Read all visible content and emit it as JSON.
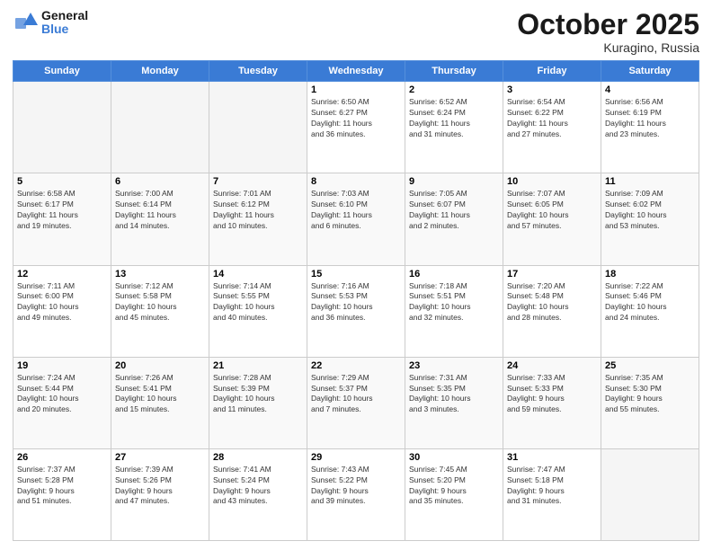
{
  "header": {
    "logo_line1": "General",
    "logo_line2": "Blue",
    "title": "October 2025",
    "subtitle": "Kuragino, Russia"
  },
  "days_of_week": [
    "Sunday",
    "Monday",
    "Tuesday",
    "Wednesday",
    "Thursday",
    "Friday",
    "Saturday"
  ],
  "weeks": [
    [
      {
        "day": "",
        "empty": true
      },
      {
        "day": "",
        "empty": true
      },
      {
        "day": "",
        "empty": true
      },
      {
        "day": "1",
        "info": "Sunrise: 6:50 AM\nSunset: 6:27 PM\nDaylight: 11 hours\nand 36 minutes."
      },
      {
        "day": "2",
        "info": "Sunrise: 6:52 AM\nSunset: 6:24 PM\nDaylight: 11 hours\nand 31 minutes."
      },
      {
        "day": "3",
        "info": "Sunrise: 6:54 AM\nSunset: 6:22 PM\nDaylight: 11 hours\nand 27 minutes."
      },
      {
        "day": "4",
        "info": "Sunrise: 6:56 AM\nSunset: 6:19 PM\nDaylight: 11 hours\nand 23 minutes."
      }
    ],
    [
      {
        "day": "5",
        "info": "Sunrise: 6:58 AM\nSunset: 6:17 PM\nDaylight: 11 hours\nand 19 minutes."
      },
      {
        "day": "6",
        "info": "Sunrise: 7:00 AM\nSunset: 6:14 PM\nDaylight: 11 hours\nand 14 minutes."
      },
      {
        "day": "7",
        "info": "Sunrise: 7:01 AM\nSunset: 6:12 PM\nDaylight: 11 hours\nand 10 minutes."
      },
      {
        "day": "8",
        "info": "Sunrise: 7:03 AM\nSunset: 6:10 PM\nDaylight: 11 hours\nand 6 minutes."
      },
      {
        "day": "9",
        "info": "Sunrise: 7:05 AM\nSunset: 6:07 PM\nDaylight: 11 hours\nand 2 minutes."
      },
      {
        "day": "10",
        "info": "Sunrise: 7:07 AM\nSunset: 6:05 PM\nDaylight: 10 hours\nand 57 minutes."
      },
      {
        "day": "11",
        "info": "Sunrise: 7:09 AM\nSunset: 6:02 PM\nDaylight: 10 hours\nand 53 minutes."
      }
    ],
    [
      {
        "day": "12",
        "info": "Sunrise: 7:11 AM\nSunset: 6:00 PM\nDaylight: 10 hours\nand 49 minutes."
      },
      {
        "day": "13",
        "info": "Sunrise: 7:12 AM\nSunset: 5:58 PM\nDaylight: 10 hours\nand 45 minutes."
      },
      {
        "day": "14",
        "info": "Sunrise: 7:14 AM\nSunset: 5:55 PM\nDaylight: 10 hours\nand 40 minutes."
      },
      {
        "day": "15",
        "info": "Sunrise: 7:16 AM\nSunset: 5:53 PM\nDaylight: 10 hours\nand 36 minutes."
      },
      {
        "day": "16",
        "info": "Sunrise: 7:18 AM\nSunset: 5:51 PM\nDaylight: 10 hours\nand 32 minutes."
      },
      {
        "day": "17",
        "info": "Sunrise: 7:20 AM\nSunset: 5:48 PM\nDaylight: 10 hours\nand 28 minutes."
      },
      {
        "day": "18",
        "info": "Sunrise: 7:22 AM\nSunset: 5:46 PM\nDaylight: 10 hours\nand 24 minutes."
      }
    ],
    [
      {
        "day": "19",
        "info": "Sunrise: 7:24 AM\nSunset: 5:44 PM\nDaylight: 10 hours\nand 20 minutes."
      },
      {
        "day": "20",
        "info": "Sunrise: 7:26 AM\nSunset: 5:41 PM\nDaylight: 10 hours\nand 15 minutes."
      },
      {
        "day": "21",
        "info": "Sunrise: 7:28 AM\nSunset: 5:39 PM\nDaylight: 10 hours\nand 11 minutes."
      },
      {
        "day": "22",
        "info": "Sunrise: 7:29 AM\nSunset: 5:37 PM\nDaylight: 10 hours\nand 7 minutes."
      },
      {
        "day": "23",
        "info": "Sunrise: 7:31 AM\nSunset: 5:35 PM\nDaylight: 10 hours\nand 3 minutes."
      },
      {
        "day": "24",
        "info": "Sunrise: 7:33 AM\nSunset: 5:33 PM\nDaylight: 9 hours\nand 59 minutes."
      },
      {
        "day": "25",
        "info": "Sunrise: 7:35 AM\nSunset: 5:30 PM\nDaylight: 9 hours\nand 55 minutes."
      }
    ],
    [
      {
        "day": "26",
        "info": "Sunrise: 7:37 AM\nSunset: 5:28 PM\nDaylight: 9 hours\nand 51 minutes."
      },
      {
        "day": "27",
        "info": "Sunrise: 7:39 AM\nSunset: 5:26 PM\nDaylight: 9 hours\nand 47 minutes."
      },
      {
        "day": "28",
        "info": "Sunrise: 7:41 AM\nSunset: 5:24 PM\nDaylight: 9 hours\nand 43 minutes."
      },
      {
        "day": "29",
        "info": "Sunrise: 7:43 AM\nSunset: 5:22 PM\nDaylight: 9 hours\nand 39 minutes."
      },
      {
        "day": "30",
        "info": "Sunrise: 7:45 AM\nSunset: 5:20 PM\nDaylight: 9 hours\nand 35 minutes."
      },
      {
        "day": "31",
        "info": "Sunrise: 7:47 AM\nSunset: 5:18 PM\nDaylight: 9 hours\nand 31 minutes."
      },
      {
        "day": "",
        "empty": true
      }
    ]
  ]
}
